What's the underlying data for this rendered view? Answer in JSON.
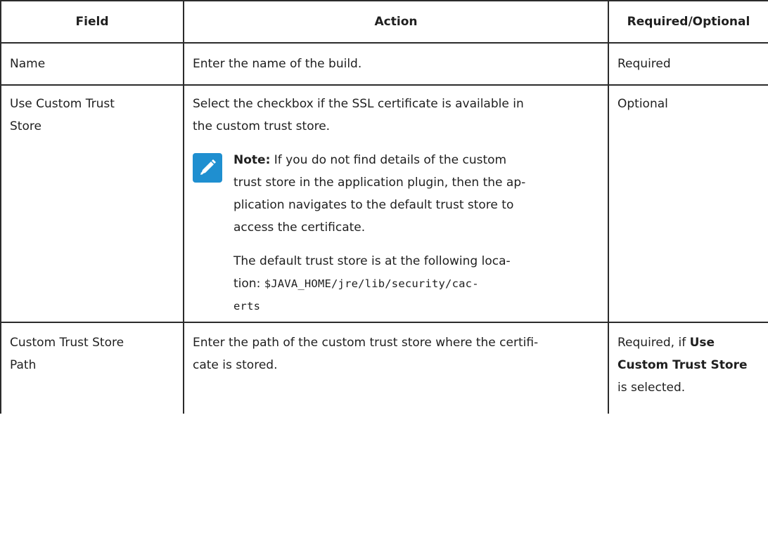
{
  "table": {
    "headers": {
      "field": "Field",
      "action": "Action",
      "required": "Required/Optional"
    },
    "rows": [
      {
        "field": "Name",
        "action": "Enter the name of the build.",
        "required": "Required"
      },
      {
        "field_line1": "Use Custom Trust",
        "field_line2": "Store",
        "action_line1": "Select the checkbox if the SSL certificate is available in",
        "action_line2": "the custom trust store.",
        "note": {
          "label": "Note:",
          "line1": " If you do not find details of the custom",
          "line2": "trust store in the application plugin, then the ap-",
          "line3": "plication navigates to the default trust store to",
          "line4": "access the certificate.",
          "p2_line1": "The default trust store is at the following loca-",
          "p2_line2": "tion:",
          "path_part1": "$JAVA_HOME/jre/lib/security/cac-",
          "path_part2": "erts"
        },
        "required": "Optional"
      },
      {
        "field_line1": "Custom Trust Store",
        "field_line2": "Path",
        "action_line1": "Enter the path of the custom trust store where the certifi-",
        "action_line2": "cate is stored.",
        "required_prefix": "Required, if ",
        "required_bold1": "Use",
        "required_bold2": "Custom Trust Store",
        "required_suffix": "is selected."
      }
    ]
  },
  "colors": {
    "note_icon_bg": "#1f8fd0",
    "border": "#2b2b2b",
    "text": "#1f1f1f"
  },
  "icons": {
    "note": "pencil-note-icon"
  }
}
